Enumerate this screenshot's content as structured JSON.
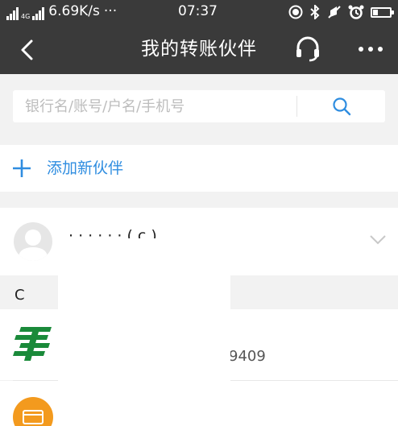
{
  "status_bar": {
    "network_tag": "4G",
    "speed": "6.69K/s",
    "dots": "···",
    "time": "07:37"
  },
  "nav": {
    "title": "我的转账伙伴"
  },
  "search": {
    "placeholder": "银行名/账号/户名/手机号",
    "value": ""
  },
  "add_partner": {
    "label": "添加新伙伴"
  },
  "contacts": [
    {
      "name": "· · · · · · ( c )"
    }
  ],
  "sections": [
    {
      "letter": "C",
      "accounts": [
        {
          "number": "9409",
          "bank_icon": "postal-bank-icon"
        },
        {
          "number": "··",
          "bank_icon": "bank-card-icon"
        }
      ]
    }
  ],
  "colors": {
    "bar_bg": "#3a3a3a",
    "accent": "#2f8de0",
    "postal_green": "#1a8a3a",
    "card_orange": "#f39a1e",
    "page_bg": "#f2f2f2"
  }
}
